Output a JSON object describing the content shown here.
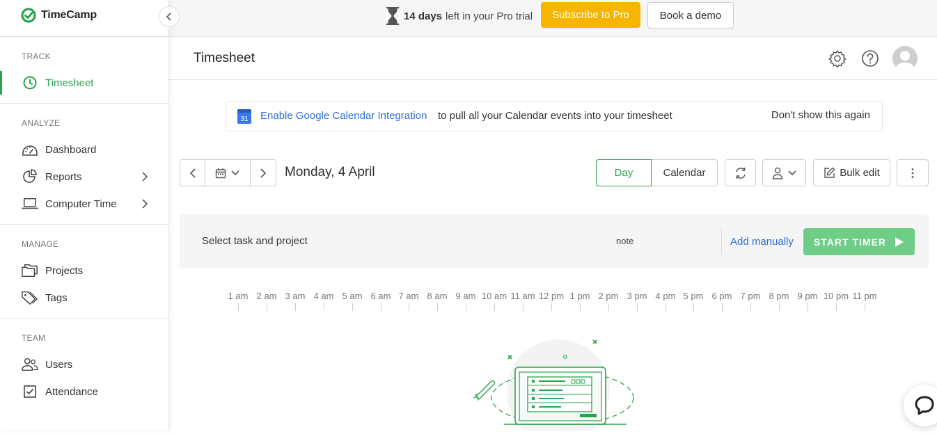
{
  "app": {
    "name": "TimeCamp"
  },
  "colors": {
    "brand_green": "#2aa44f",
    "start_timer": "#6fcd87",
    "subscribe": "#f7b500",
    "link_blue": "#2f6fd6"
  },
  "topbar": {
    "trial_days": "14 days",
    "trial_text": "left in your Pro trial",
    "subscribe_label": "Subscribe to Pro",
    "demo_label": "Book a demo"
  },
  "sidebar": {
    "sections": [
      {
        "label": "TRACK",
        "items": [
          {
            "label": "Timesheet",
            "icon": "clock-icon",
            "active": true
          }
        ]
      },
      {
        "label": "ANALYZE",
        "items": [
          {
            "label": "Dashboard",
            "icon": "gauge-icon"
          },
          {
            "label": "Reports",
            "icon": "pie-chart-icon",
            "has_submenu": true
          },
          {
            "label": "Computer Time",
            "icon": "laptop-icon",
            "has_submenu": true
          }
        ]
      },
      {
        "label": "MANAGE",
        "items": [
          {
            "label": "Projects",
            "icon": "folders-icon"
          },
          {
            "label": "Tags",
            "icon": "tags-icon"
          }
        ]
      },
      {
        "label": "TEAM",
        "items": [
          {
            "label": "Users",
            "icon": "users-icon"
          },
          {
            "label": "Attendance",
            "icon": "checkbox-icon"
          }
        ]
      }
    ]
  },
  "header": {
    "title": "Timesheet"
  },
  "banner": {
    "calendar_day": "31",
    "link_text": "Enable Google Calendar Integration",
    "rest_text": "to pull all your Calendar events into your timesheet",
    "dismiss_text": "Don't show this again"
  },
  "toolbar": {
    "date": "Monday, 4 April",
    "view_day": "Day",
    "view_calendar": "Calendar",
    "bulk_edit": "Bulk edit"
  },
  "entry": {
    "task_placeholder": "Select task and project",
    "note_placeholder": "note",
    "add_manually": "Add manually",
    "start_timer": "START TIMER"
  },
  "timeline": {
    "hours": [
      "1 am",
      "2 am",
      "3 am",
      "4 am",
      "5 am",
      "6 am",
      "7 am",
      "8 am",
      "9 am",
      "10 am",
      "11 am",
      "12 pm",
      "1 pm",
      "2 pm",
      "3 pm",
      "4 pm",
      "5 pm",
      "6 pm",
      "7 pm",
      "8 pm",
      "9 pm",
      "10 pm",
      "11 pm"
    ]
  }
}
